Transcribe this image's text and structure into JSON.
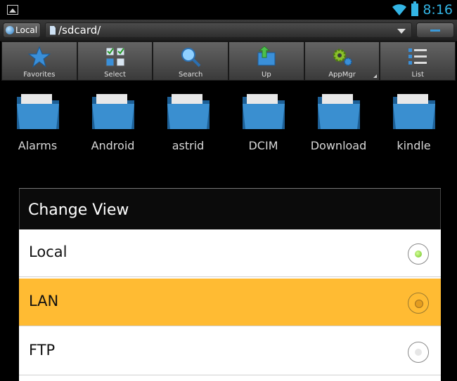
{
  "status_bar": {
    "time": "8:16"
  },
  "path_bar": {
    "location_button": "Local",
    "path": "/sdcard/"
  },
  "toolbar": [
    {
      "label": "Favorites",
      "icon": "star-icon"
    },
    {
      "label": "Select",
      "icon": "select-grid-icon"
    },
    {
      "label": "Search",
      "icon": "search-icon"
    },
    {
      "label": "Up",
      "icon": "folder-up-icon"
    },
    {
      "label": "AppMgr",
      "icon": "gear-icon"
    },
    {
      "label": "List",
      "icon": "list-icon"
    }
  ],
  "folders": [
    "Alarms",
    "Android",
    "astrid",
    "DCIM",
    "Download",
    "kindle"
  ],
  "dialog": {
    "title": "Change View",
    "options": [
      {
        "label": "Local",
        "selected": true
      },
      {
        "label": "LAN",
        "highlighted": true
      },
      {
        "label": "FTP"
      }
    ]
  },
  "colors": {
    "accent": "#33b5e5",
    "highlight": "#ffbb33",
    "radio_on": "#6cc021"
  }
}
